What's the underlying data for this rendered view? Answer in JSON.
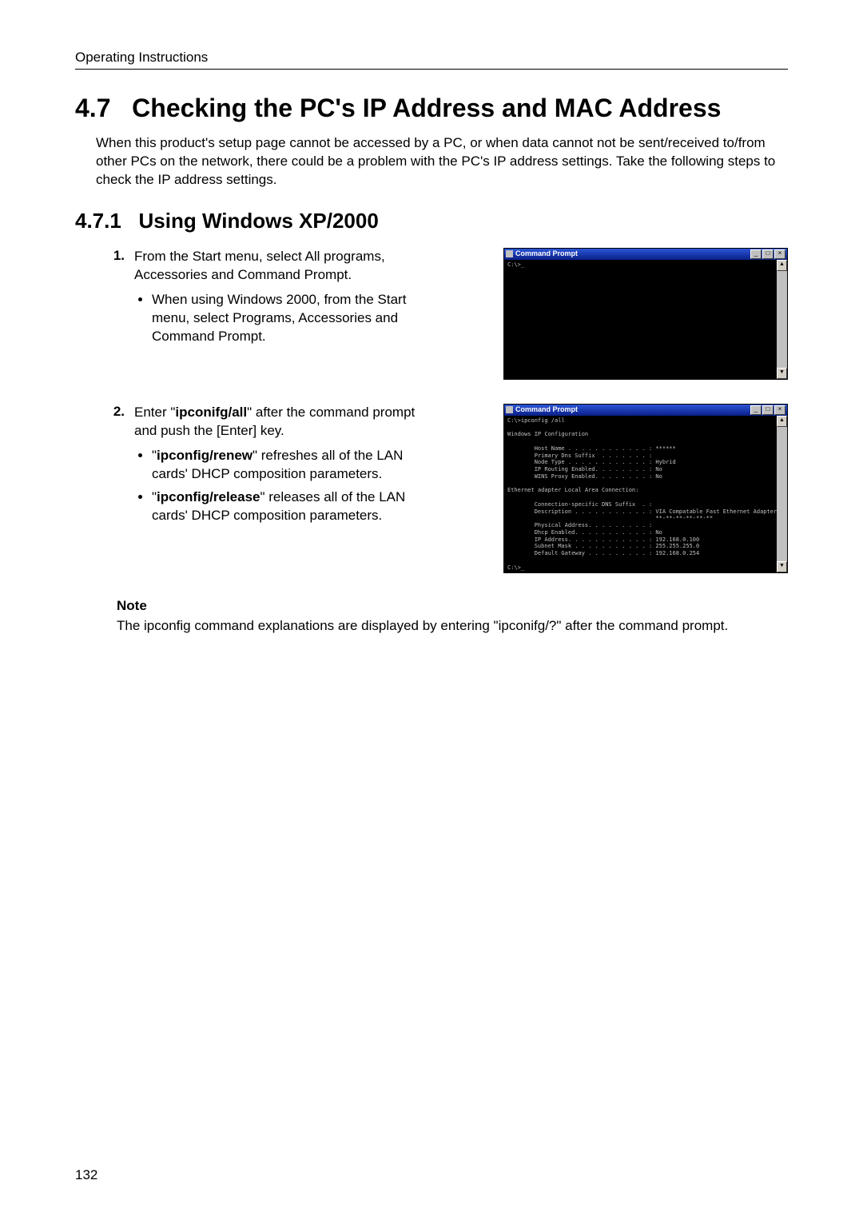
{
  "running_head": "Operating Instructions",
  "section_number": "4.7",
  "section_title": "Checking the PC's IP Address and MAC Address",
  "intro": "When this product's setup page cannot be accessed by a PC, or when data cannot not be sent/received to/from other PCs on the network, there could be a problem with the PC's IP address settings. Take the following steps to check the IP address settings.",
  "subsection_number": "4.7.1",
  "subsection_title": "Using Windows XP/2000",
  "steps": [
    {
      "n": "1.",
      "text": "From the Start menu, select All programs, Accessories and Command Prompt.",
      "bullets": [
        "When using Windows 2000, from the Start menu, select Programs, Accessories and Command Prompt."
      ]
    },
    {
      "n": "2.",
      "text_pre": "Enter \"",
      "text_bold": "ipconifg/all",
      "text_post": "\" after the command prompt and push the [Enter] key.",
      "bullets_rich": [
        {
          "pre": "\"",
          "bold": "ipconfig/renew",
          "post": "\" refreshes all of the LAN cards' DHCP composition parameters."
        },
        {
          "pre": "\"",
          "bold": "ipconfig/release",
          "post": "\" releases all of the LAN cards' DHCP composition parameters."
        }
      ]
    }
  ],
  "cmd1": {
    "title": "Command Prompt",
    "content": "C:\\>_"
  },
  "cmd2": {
    "title": "Command Prompt",
    "content": "C:\\>ipconfig /all\n\nWindows IP Configuration\n\n        Host Name . . . . . . . . . . . . : ******\n        Primary Dns Suffix  . . . . . . . :\n        Node Type . . . . . . . . . . . . : Hybrid\n        IP Routing Enabled. . . . . . . . : No\n        WINS Proxy Enabled. . . . . . . . : No\n\nEthernet adapter Local Area Connection:\n\n        Connection-specific DNS Suffix  . :\n        Description . . . . . . . . . . . : VIA Compatable Fast Ethernet Adapter\n                                            **-**-**-**-**-**\n        Physical Address. . . . . . . . . :\n        Dhcp Enabled. . . . . . . . . . . : No\n        IP Address. . . . . . . . . . . . : 192.168.0.100\n        Subnet Mask . . . . . . . . . . . : 255.255.255.0\n        Default Gateway . . . . . . . . . : 192.168.0.254\n\nC:\\>_"
  },
  "note_label": "Note",
  "note_text": "The ipconfig command explanations are displayed by entering \"ipconifg/?\" after the command prompt.",
  "page_number": "132",
  "win_btn_min": "_",
  "win_btn_max": "□",
  "win_btn_close": "×",
  "arrow_up": "▲",
  "arrow_down": "▼"
}
